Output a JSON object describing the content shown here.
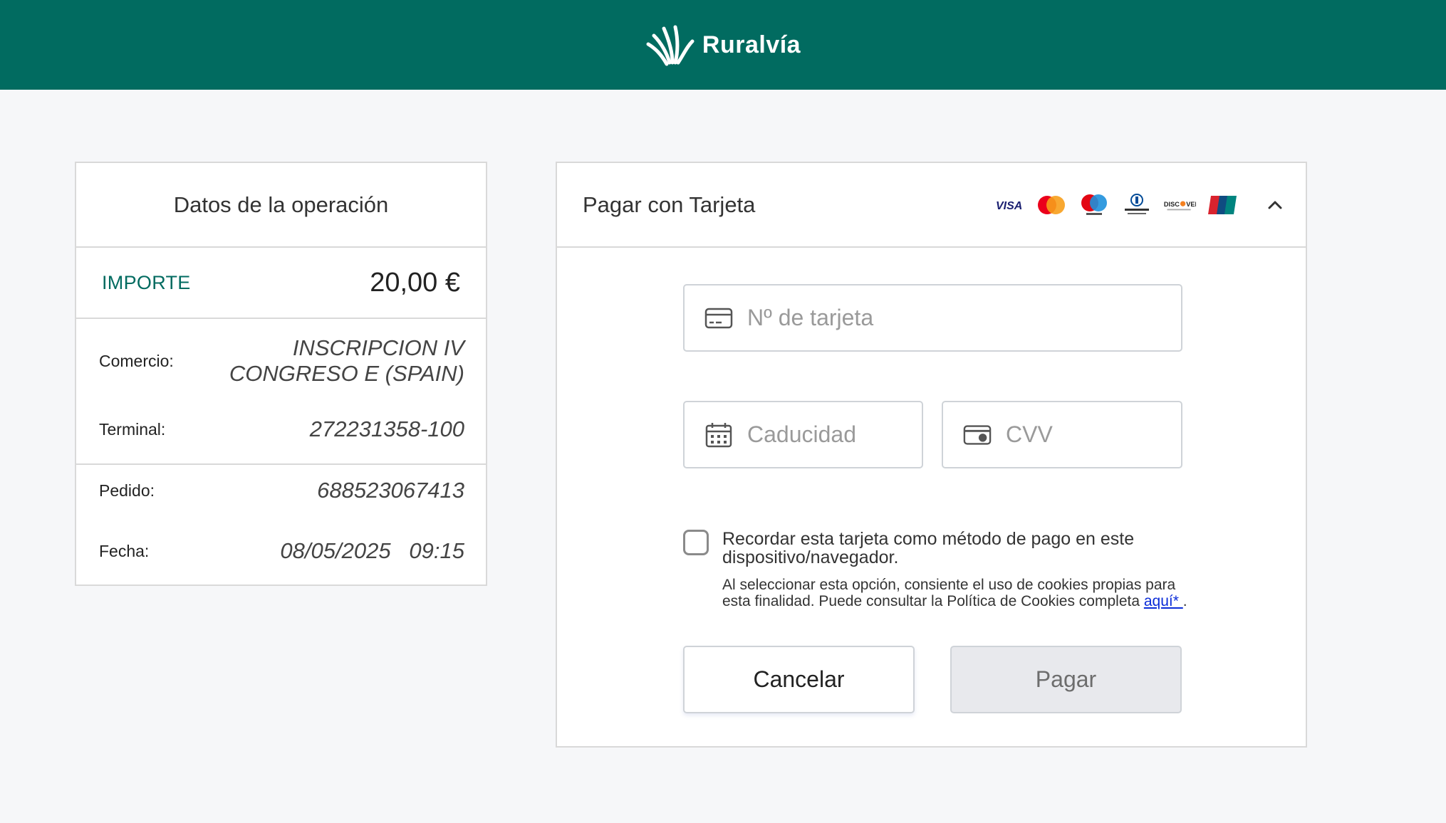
{
  "header": {
    "brand_name": "Ruralvía",
    "bg_color": "#016b60"
  },
  "operation": {
    "title": "Datos de la operación",
    "amount_label": "IMPORTE",
    "amount_value": "20,00 €",
    "rows": [
      {
        "key": "Comercio:",
        "value_line1": "INSCRIPCION IV",
        "value_line2": "CONGRESO E (SPAIN)"
      },
      {
        "key": "Terminal:",
        "value": "272231358-100"
      },
      {
        "key": "Pedido:",
        "value": "688523067413"
      },
      {
        "key": "Fecha:",
        "value": "08/05/2025   09:15"
      }
    ]
  },
  "payment": {
    "title": "Pagar con Tarjeta",
    "card_brands": [
      "VISA",
      "mastercard",
      "maestro",
      "Diners Club",
      "DISCOVER",
      "UnionPay"
    ],
    "card_number_placeholder": "Nº de tarjeta",
    "expiry_placeholder": "Caducidad",
    "cvv_placeholder": "CVV",
    "remember_label": "Recordar esta tarjeta como método de pago en este dispositivo/navegador.",
    "cookies_note": "Al seleccionar esta opción, consiente el uso de cookies propias para esta finalidad. Puede consultar la Política de Cookies completa ",
    "cookies_link": "aquí* ",
    "cookies_end": ".",
    "cancel_label": "Cancelar",
    "pay_label": "Pagar"
  },
  "icons": [
    "ruralvia-logo-icon",
    "card-icon",
    "calendar-icon",
    "cvv-card-icon",
    "chevron-up-icon"
  ]
}
